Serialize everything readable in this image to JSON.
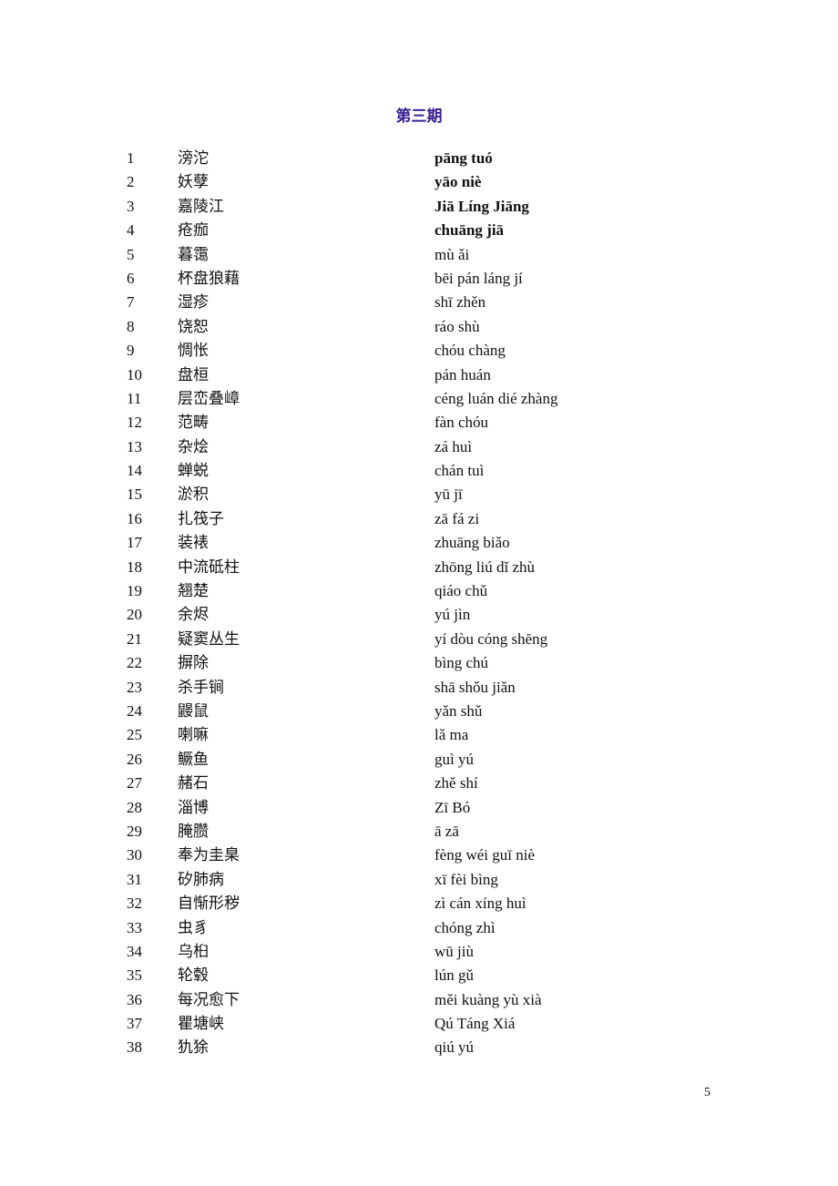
{
  "title": "第三期",
  "page_number": "5",
  "entries": [
    {
      "num": "1",
      "hanzi": "滂沱",
      "pinyin": "pāng tuó",
      "bold": true
    },
    {
      "num": "2",
      "hanzi": "妖孽",
      "pinyin": "yāo niè",
      "bold": true
    },
    {
      "num": "3",
      "hanzi": "嘉陵江",
      "pinyin": "Jiā Líng Jiāng",
      "bold": true
    },
    {
      "num": "4",
      "hanzi": "疮痂",
      "pinyin": "chuāng jiā",
      "bold": true
    },
    {
      "num": "5",
      "hanzi": "暮霭",
      "pinyin": "mù ǎi",
      "bold": false
    },
    {
      "num": "6",
      "hanzi": "杯盘狼藉",
      "pinyin": "bēi pán láng jí",
      "bold": false
    },
    {
      "num": "7",
      "hanzi": "湿疹",
      "pinyin": "shī zhěn",
      "bold": false
    },
    {
      "num": "8",
      "hanzi": "饶恕",
      "pinyin": "ráo shù",
      "bold": false
    },
    {
      "num": "9",
      "hanzi": "惆怅",
      "pinyin": "chóu chàng",
      "bold": false
    },
    {
      "num": "10",
      "hanzi": "盘桓",
      "pinyin": "pán huán",
      "bold": false
    },
    {
      "num": "11",
      "hanzi": "层峦叠嶂",
      "pinyin": "céng luán dié zhàng",
      "bold": false
    },
    {
      "num": "12",
      "hanzi": "范畴",
      "pinyin": "fàn chóu",
      "bold": false
    },
    {
      "num": "13",
      "hanzi": "杂烩",
      "pinyin": "zá huì",
      "bold": false
    },
    {
      "num": "14",
      "hanzi": "蝉蜕",
      "pinyin": "chán tuì",
      "bold": false
    },
    {
      "num": "15",
      "hanzi": "淤积",
      "pinyin": "yū jī",
      "bold": false
    },
    {
      "num": "16",
      "hanzi": "扎筏子",
      "pinyin": "zā fá zi",
      "bold": false
    },
    {
      "num": "17",
      "hanzi": "装裱",
      "pinyin": "zhuāng biǎo",
      "bold": false
    },
    {
      "num": "18",
      "hanzi": "中流砥柱",
      "pinyin": "zhōng liú dǐ zhù",
      "bold": false
    },
    {
      "num": "19",
      "hanzi": "翘楚",
      "pinyin": "qiáo chǔ",
      "bold": false
    },
    {
      "num": "20",
      "hanzi": "余烬",
      "pinyin": "yú jìn",
      "bold": false
    },
    {
      "num": "21",
      "hanzi": "疑窦丛生",
      "pinyin": "yí dòu cóng shēng",
      "bold": false
    },
    {
      "num": "22",
      "hanzi": "摒除",
      "pinyin": "bìng chú",
      "bold": false
    },
    {
      "num": "23",
      "hanzi": "杀手锏",
      "pinyin": "shā shǒu jiǎn",
      "bold": false
    },
    {
      "num": "24",
      "hanzi": "鼹鼠",
      "pinyin": "yǎn shǔ",
      "bold": false
    },
    {
      "num": "25",
      "hanzi": "喇嘛",
      "pinyin": "lǎ ma",
      "bold": false
    },
    {
      "num": "26",
      "hanzi": "鳜鱼",
      "pinyin": "guì yú",
      "bold": false
    },
    {
      "num": "27",
      "hanzi": "赭石",
      "pinyin": "zhě shí",
      "bold": false
    },
    {
      "num": "28",
      "hanzi": "淄博",
      "pinyin": "Zī Bó",
      "bold": false
    },
    {
      "num": "29",
      "hanzi": "腌臜",
      "pinyin": "ā zā",
      "bold": false
    },
    {
      "num": "30",
      "hanzi": "奉为圭臬",
      "pinyin": "fèng wéi guī niè",
      "bold": false
    },
    {
      "num": "31",
      "hanzi": "矽肺病",
      "pinyin": "xī fèi bìng",
      "bold": false
    },
    {
      "num": "32",
      "hanzi": "自惭形秽",
      "pinyin": "zì cán xíng huì",
      "bold": false
    },
    {
      "num": "33",
      "hanzi": "虫豸",
      "pinyin": "chóng zhì",
      "bold": false
    },
    {
      "num": "34",
      "hanzi": "乌桕",
      "pinyin": "wū jiù",
      "bold": false
    },
    {
      "num": "35",
      "hanzi": "轮毂",
      "pinyin": "lún gǔ",
      "bold": false
    },
    {
      "num": "36",
      "hanzi": "每况愈下",
      "pinyin": "měi kuàng yù xià",
      "bold": false
    },
    {
      "num": "37",
      "hanzi": "瞿塘峡",
      "pinyin": "Qú Táng Xiá",
      "bold": false
    },
    {
      "num": "38",
      "hanzi": "犰狳",
      "pinyin": "qiú yú",
      "bold": false
    }
  ]
}
